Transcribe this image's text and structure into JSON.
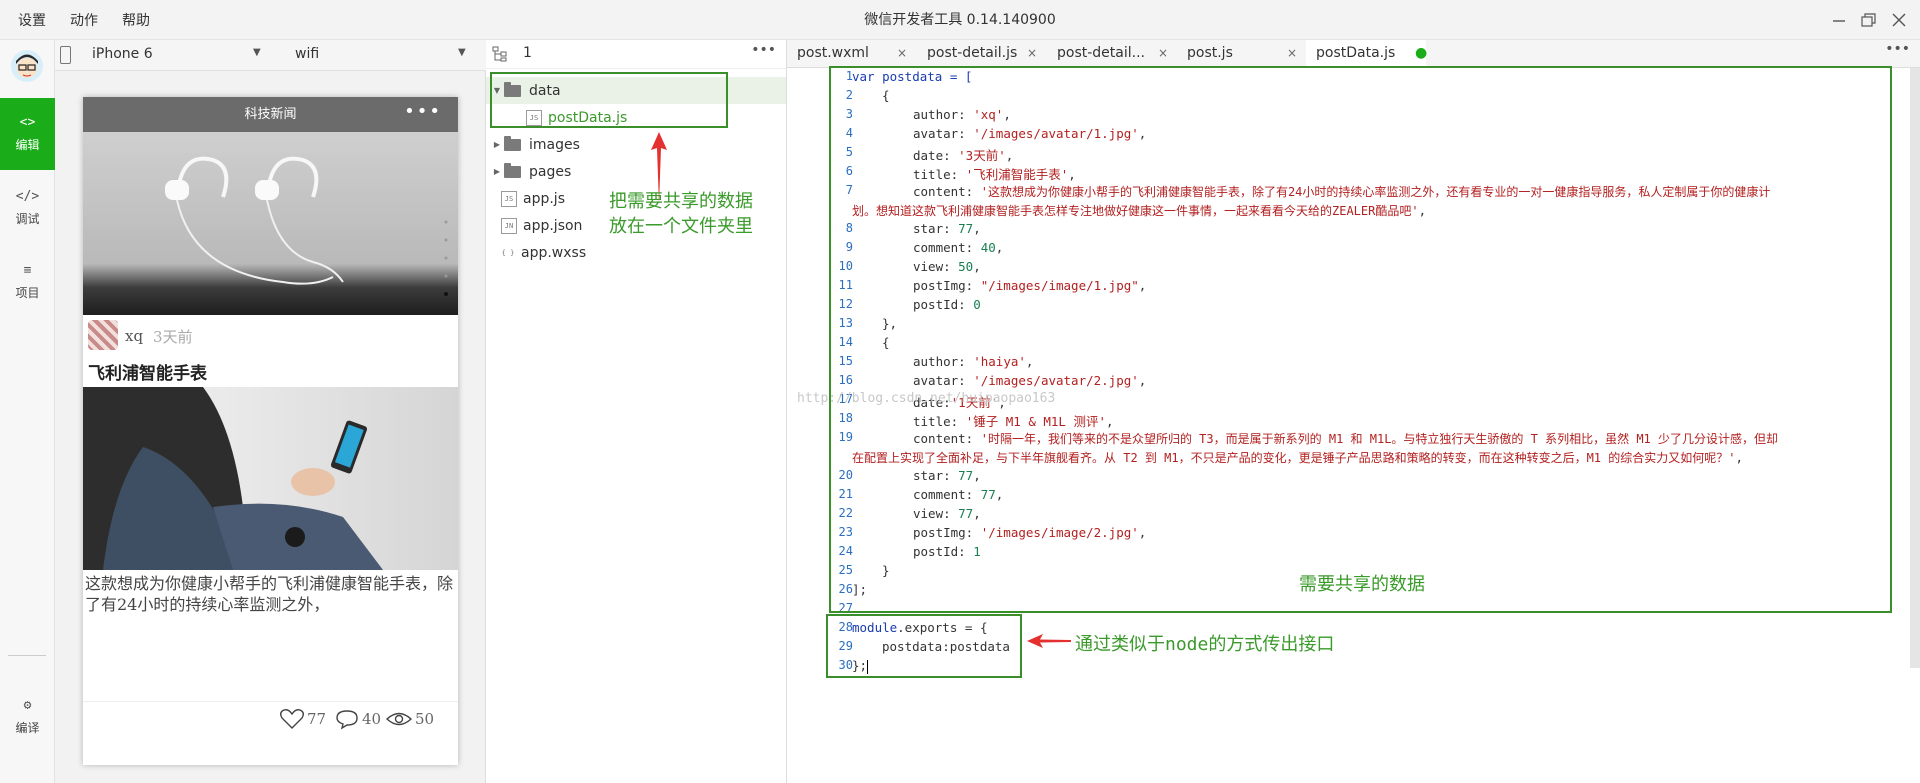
{
  "menu": {
    "items": [
      "设置",
      "动作",
      "帮助"
    ]
  },
  "window": {
    "title": "微信开发者工具 0.14.140900"
  },
  "activity": {
    "items": [
      {
        "label": "编辑",
        "icon": "<>"
      },
      {
        "label": "调试",
        "icon": "</>"
      },
      {
        "label": "项目",
        "icon": "≡"
      },
      {
        "label": "编译",
        "icon": "⚙"
      }
    ],
    "colors": {
      "accent": "#1aad19"
    }
  },
  "simulator": {
    "device": "iPhone 6",
    "network": "wifi",
    "nav_title": "科技新闻",
    "nav_dots": "•••",
    "post": {
      "author": "xq",
      "date": "3天前",
      "title": "飞利浦智能手表",
      "content": "这款想成为你健康小帮手的飞利浦健康智能手表，除了有24小时的持续心率监测之外，",
      "likes": "77",
      "comments": "40",
      "views": "50"
    }
  },
  "explorer": {
    "count": "1",
    "more": "•••",
    "tree": [
      {
        "name": "data",
        "type": "folder",
        "expanded": true
      },
      {
        "name": "postData.js",
        "type": "file",
        "icon": "JS"
      },
      {
        "name": "images",
        "type": "folder",
        "expanded": false
      },
      {
        "name": "pages",
        "type": "folder",
        "expanded": false
      },
      {
        "name": "app.js",
        "type": "file",
        "icon": "JS"
      },
      {
        "name": "app.json",
        "type": "file",
        "icon": "JN"
      },
      {
        "name": "app.wxss",
        "type": "file",
        "icon": "{ }"
      }
    ],
    "annotation": [
      "把需要共享的数据",
      "放在一个文件夹里"
    ]
  },
  "editor": {
    "tabs": [
      "post.wxml",
      "post-detail.js",
      "post-detail...",
      "post.js",
      "postData.js"
    ],
    "close_glyph": "×",
    "dirty_glyph": "●",
    "more": "•••",
    "watermark": "http://blog.csdn.net/huipaopao163",
    "annotation_data": "需要共享的数据",
    "annotation_export": "通过类似于node的方式传出接口",
    "code": {
      "l1": "var postdata = [",
      "l2": "{",
      "l3_val": "'xq'",
      "l4_val": "'/images/avatar/1.jpg'",
      "l5_val": "'3天前'",
      "l6_val": "'飞利浦智能手表'",
      "l7a_val": "'这款想成为你健康小帮手的飞利浦健康智能手表，除了有24小时的持续心率监测之外，还有看专业的一对一健康指导服务，私人定制属于你的健康计",
      "l7b_val": "划。想知道这款飞利浦健康智能手表怎样专注地做好健康这一件事情，一起来看看今天给的ZEALER酷品吧'",
      "l8_val": "77",
      "l9_val": "40",
      "l10_val": "50",
      "l11_val": "\"/images/image/1.jpg\"",
      "l12_val": "0",
      "l13": "},",
      "l14": "{",
      "l15_val": "'haiya'",
      "l16_val": "'/images/avatar/2.jpg'",
      "l17_val": "'1天前'",
      "l18_val": "'锤子 M1 & M1L 测评'",
      "l19a_val": "'时隔一年，我们等来的不是众望所归的 T3，而是属于新系列的 M1 和 M1L。与特立独行天生骄傲的 T 系列相比，虽然 M1 少了几分设计感，但却",
      "l19b_val": "在配置上实现了全面补足，与下半年旗舰看齐。从 T2 到 M1，不只是产品的变化，更是锤子产品思路和策略的转变，而在这种转变之后，M1 的综合实力又如何呢？'",
      "l20_val": "77",
      "l21_val": "77",
      "l22_val": "77",
      "l23_val": "'/images/image/2.jpg'",
      "l24_val": "1",
      "l25": "}",
      "l26": "];",
      "l28a": "module",
      "l28b": ".exports = {",
      "l29": "postdata:postdata",
      "l30": "};",
      "keys": {
        "author": "author: ",
        "avatar": "avatar: ",
        "date": "date: ",
        "date_tight": "date:",
        "title": "title: ",
        "content": "content: ",
        "star": "star: ",
        "comment": "comment: ",
        "view": "view: ",
        "postImg": "postImg: ",
        "postId": "postId: "
      }
    }
  }
}
